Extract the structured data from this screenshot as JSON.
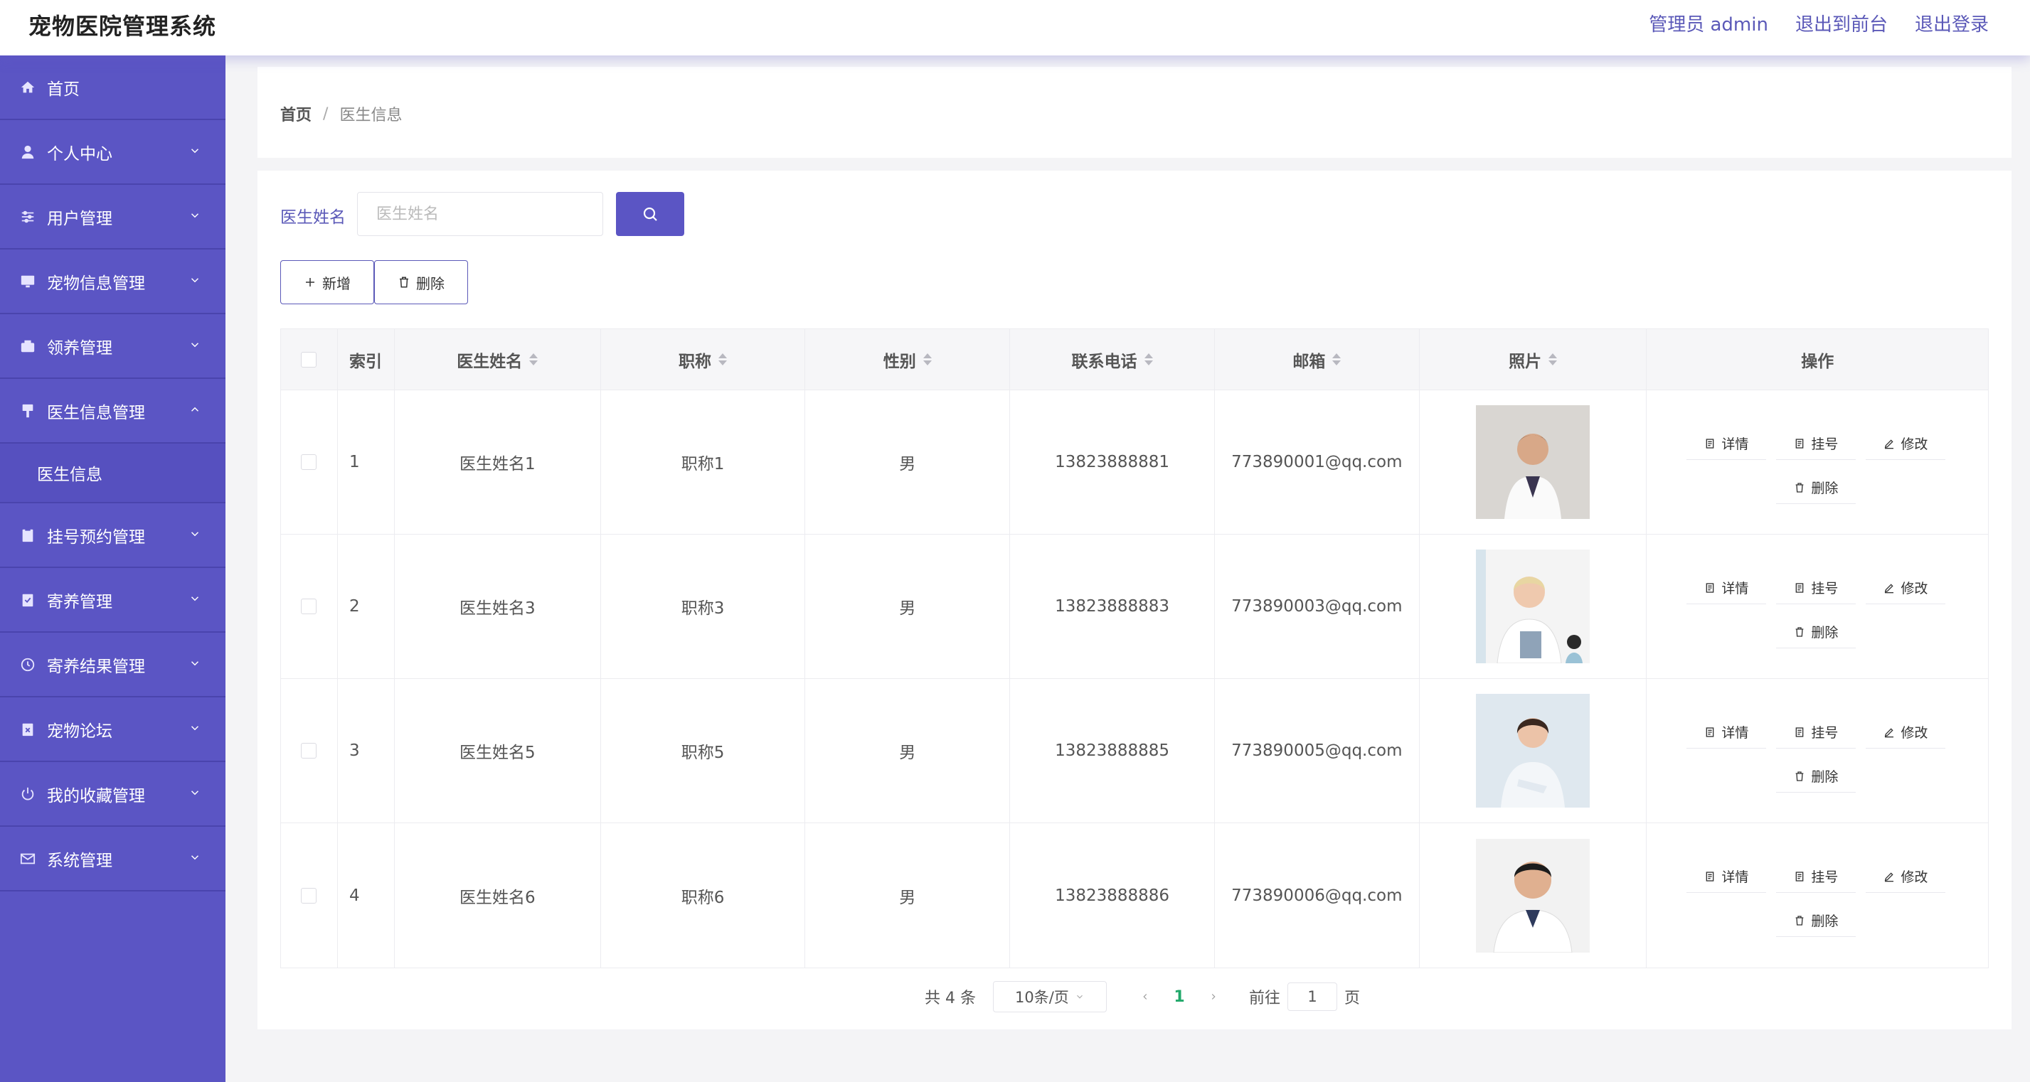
{
  "app": {
    "title": "宠物医院管理系统"
  },
  "header": {
    "links": [
      "管理员 admin",
      "退出到前台",
      "退出登录"
    ]
  },
  "sidebar": {
    "items": [
      {
        "label": "首页",
        "icon": "home-icon"
      },
      {
        "label": "个人中心",
        "icon": "user-icon"
      },
      {
        "label": "用户管理",
        "icon": "sliders-icon"
      },
      {
        "label": "宠物信息管理",
        "icon": "monitor-icon"
      },
      {
        "label": "领养管理",
        "icon": "camera-icon"
      },
      {
        "label": "医生信息管理",
        "icon": "brush-icon",
        "expanded": true,
        "children": [
          "医生信息"
        ]
      },
      {
        "label": "挂号预约管理",
        "icon": "clipboard-icon"
      },
      {
        "label": "寄养管理",
        "icon": "checklist-icon"
      },
      {
        "label": "寄养结果管理",
        "icon": "clock-icon"
      },
      {
        "label": "宠物论坛",
        "icon": "clipboard-x-icon"
      },
      {
        "label": "我的收藏管理",
        "icon": "power-icon"
      },
      {
        "label": "系统管理",
        "icon": "mail-icon"
      }
    ]
  },
  "breadcrumb": {
    "home": "首页",
    "separator": "/",
    "current": "医生信息"
  },
  "search": {
    "label": "医生姓名",
    "placeholder": "医生姓名",
    "value": ""
  },
  "actions": {
    "add": "新增",
    "delete": "删除"
  },
  "table": {
    "headers": [
      "索引",
      "医生姓名",
      "职称",
      "性别",
      "联系电话",
      "邮箱",
      "照片",
      "操作"
    ],
    "rows": [
      {
        "index": "1",
        "name": "医生姓名1",
        "title": "职称1",
        "gender": "男",
        "phone": "13823888881",
        "email": "773890001@qq.com"
      },
      {
        "index": "2",
        "name": "医生姓名3",
        "title": "职称3",
        "gender": "男",
        "phone": "13823888883",
        "email": "773890003@qq.com"
      },
      {
        "index": "3",
        "name": "医生姓名5",
        "title": "职称5",
        "gender": "男",
        "phone": "13823888885",
        "email": "773890005@qq.com"
      },
      {
        "index": "4",
        "name": "医生姓名6",
        "title": "职称6",
        "gender": "男",
        "phone": "13823888886",
        "email": "773890006@qq.com"
      }
    ],
    "row_actions": {
      "detail": "详情",
      "register": "挂号",
      "edit": "修改",
      "delete": "删除"
    }
  },
  "pagination": {
    "total": "共 4 条",
    "page_size": "10条/页",
    "current": "1",
    "goto_prefix": "前往",
    "goto_value": "1",
    "goto_suffix": "页"
  },
  "colors": {
    "primary": "#5b55c4",
    "accent_text": "#5b59b8",
    "active_page": "#21a86a"
  }
}
